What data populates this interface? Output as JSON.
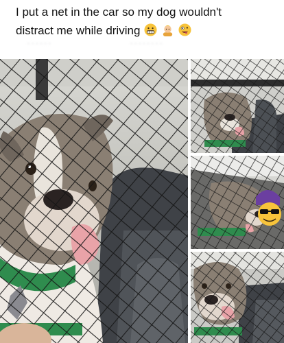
{
  "post": {
    "caption_line1": "I put a net in the car so my dog wouldn't",
    "caption_line2": "distract me while driving",
    "emojis": [
      "grimacing-face",
      "person-with-blond-hair",
      "zany-face"
    ],
    "blurred_meta_left": "· · · ·  ·  ·",
    "blurred_meta_right": "· ·  · ·  ·  ·  ·  ·"
  },
  "photos": [
    {
      "id": "main",
      "description": "dog-behind-car-net-close-up"
    },
    {
      "id": "top-right",
      "description": "dog-behind-car-net"
    },
    {
      "id": "mid-right",
      "description": "dog-pressed-against-net"
    },
    {
      "id": "bottom-right",
      "description": "dog-face-behind-net"
    }
  ],
  "colors": {
    "net": "#1a1a1a",
    "dog_fur": "#8a7f73",
    "seat": "#4a4d52",
    "harness": "#2f8c4e"
  }
}
